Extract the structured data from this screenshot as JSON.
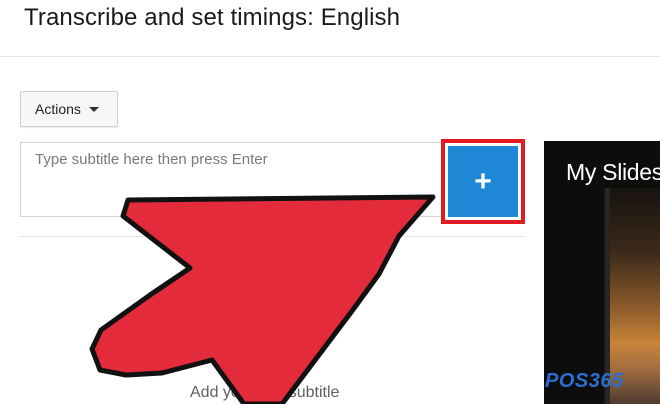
{
  "page": {
    "title": "Transcribe and set timings: English"
  },
  "toolbar": {
    "actions_label": "Actions",
    "actions_icon": "caret-down-icon"
  },
  "subtitle_editor": {
    "placeholder": "Type subtitle here then press Enter",
    "value": "",
    "add_button_label": "+",
    "add_button_color": "#1e88d6",
    "highlight_color": "#e01b24"
  },
  "empty_state": {
    "text": "Add your first subtitle"
  },
  "video": {
    "title": "My Slides"
  },
  "annotation": {
    "arrow_color": "#e32b3c",
    "arrow_icon": "pointer-arrow-icon"
  },
  "watermark": {
    "text": "POS365"
  }
}
